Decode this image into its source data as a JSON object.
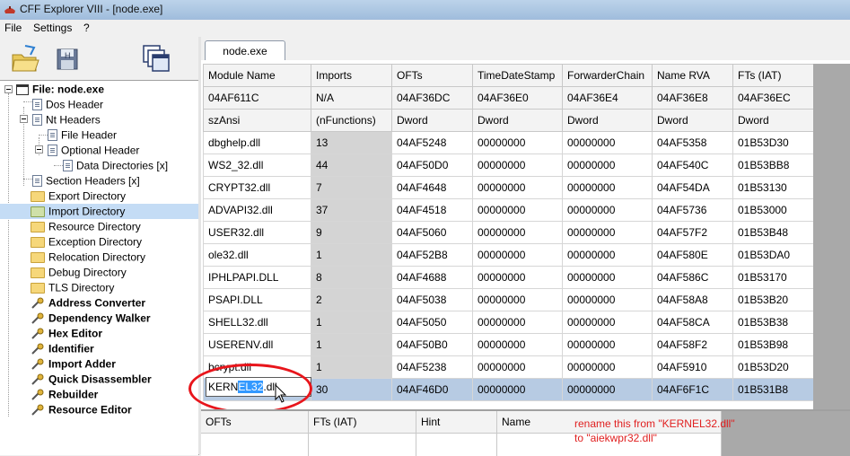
{
  "window": {
    "title": "CFF Explorer VIII - [node.exe]"
  },
  "menu": {
    "items": [
      "File",
      "Settings",
      "?"
    ]
  },
  "toolbar": {
    "buttons": [
      "open-folder-icon",
      "save-disk-icon",
      "windows-icon"
    ]
  },
  "tree": {
    "items": [
      {
        "label": "File: node.exe",
        "icon": "window-icon",
        "bold": true
      },
      {
        "label": "Dos Header",
        "icon": "document-icon"
      },
      {
        "label": "Nt Headers",
        "icon": "document-icon"
      },
      {
        "label": "File Header",
        "icon": "document-icon"
      },
      {
        "label": "Optional Header",
        "icon": "document-icon"
      },
      {
        "label": "Data Directories [x]",
        "icon": "document-icon"
      },
      {
        "label": "Section Headers [x]",
        "icon": "document-icon"
      },
      {
        "label": "Export Directory",
        "icon": "folder-icon"
      },
      {
        "label": "Import Directory",
        "icon": "folder-open-icon",
        "selected": true
      },
      {
        "label": "Resource Directory",
        "icon": "folder-icon"
      },
      {
        "label": "Exception Directory",
        "icon": "folder-icon"
      },
      {
        "label": "Relocation Directory",
        "icon": "folder-icon"
      },
      {
        "label": "Debug Directory",
        "icon": "folder-icon"
      },
      {
        "label": "TLS Directory",
        "icon": "folder-icon"
      },
      {
        "label": "Address Converter",
        "icon": "tool-icon",
        "bold": true
      },
      {
        "label": "Dependency Walker",
        "icon": "tool-icon",
        "bold": true
      },
      {
        "label": "Hex Editor",
        "icon": "tool-icon",
        "bold": true
      },
      {
        "label": "Identifier",
        "icon": "tool-icon",
        "bold": true
      },
      {
        "label": "Import Adder",
        "icon": "tool-icon",
        "bold": true
      },
      {
        "label": "Quick Disassembler",
        "icon": "tool-icon",
        "bold": true
      },
      {
        "label": "Rebuilder",
        "icon": "tool-icon",
        "bold": true
      },
      {
        "label": "Resource Editor",
        "icon": "tool-icon",
        "bold": true
      }
    ]
  },
  "tab": {
    "label": "node.exe"
  },
  "grid": {
    "columns": [
      "Module Name",
      "Imports",
      "OFTs",
      "TimeDateStamp",
      "ForwarderChain",
      "Name RVA",
      "FTs (IAT)"
    ],
    "offsets": [
      "04AF611C",
      "N/A",
      "04AF36DC",
      "04AF36E0",
      "04AF36E4",
      "04AF36E8",
      "04AF36EC"
    ],
    "types": [
      "szAnsi",
      "(nFunctions)",
      "Dword",
      "Dword",
      "Dword",
      "Dword",
      "Dword"
    ],
    "rows": [
      [
        "dbghelp.dll",
        "13",
        "04AF5248",
        "00000000",
        "00000000",
        "04AF5358",
        "01B53D30"
      ],
      [
        "WS2_32.dll",
        "44",
        "04AF50D0",
        "00000000",
        "00000000",
        "04AF540C",
        "01B53BB8"
      ],
      [
        "CRYPT32.dll",
        "7",
        "04AF4648",
        "00000000",
        "00000000",
        "04AF54DA",
        "01B53130"
      ],
      [
        "ADVAPI32.dll",
        "37",
        "04AF4518",
        "00000000",
        "00000000",
        "04AF5736",
        "01B53000"
      ],
      [
        "USER32.dll",
        "9",
        "04AF5060",
        "00000000",
        "00000000",
        "04AF57F2",
        "01B53B48"
      ],
      [
        "ole32.dll",
        "1",
        "04AF52B8",
        "00000000",
        "00000000",
        "04AF580E",
        "01B53DA0"
      ],
      [
        "IPHLPAPI.DLL",
        "8",
        "04AF4688",
        "00000000",
        "00000000",
        "04AF586C",
        "01B53170"
      ],
      [
        "PSAPI.DLL",
        "2",
        "04AF5038",
        "00000000",
        "00000000",
        "04AF58A8",
        "01B53B20"
      ],
      [
        "SHELL32.dll",
        "1",
        "04AF5050",
        "00000000",
        "00000000",
        "04AF58CA",
        "01B53B38"
      ],
      [
        "USERENV.dll",
        "1",
        "04AF50B0",
        "00000000",
        "00000000",
        "04AF58F2",
        "01B53B98"
      ],
      [
        "bcrypt.dll",
        "1",
        "04AF5238",
        "00000000",
        "00000000",
        "04AF5910",
        "01B53D20"
      ],
      [
        "",
        "30",
        "04AF46D0",
        "00000000",
        "00000000",
        "04AF6F1C",
        "01B531B8"
      ]
    ],
    "selected_row_index": 11
  },
  "editor": {
    "prefix": "KERN",
    "selected": "EL32",
    "suffix": ".dll"
  },
  "bottom_grid": {
    "columns": [
      "OFTs",
      "FTs (IAT)",
      "Hint",
      "Name"
    ]
  },
  "annotation": {
    "line1": "rename this from \"KERNEL32.dll\"",
    "line2": "to \"aiekwpr32.dll\"",
    "color": "#e02020"
  }
}
